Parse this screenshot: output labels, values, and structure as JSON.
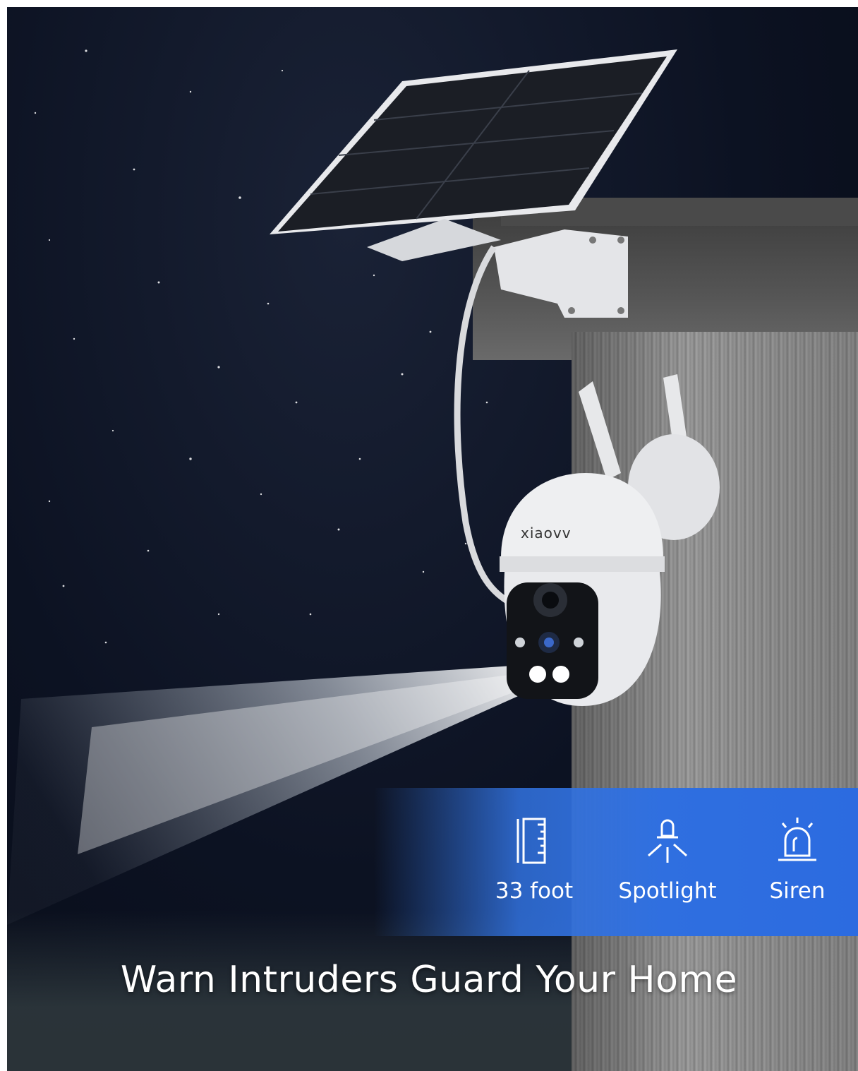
{
  "brand": "xiaovv",
  "features": [
    {
      "label": "33 foot",
      "icon": "ruler-icon"
    },
    {
      "label": "Spotlight",
      "icon": "spotlight-icon"
    },
    {
      "label": "Siren",
      "icon": "siren-icon"
    }
  ],
  "headline": "Warn Intruders Guard Your Home",
  "colors": {
    "panel_blue": "#2f6fe0",
    "night_sky": "#0c1222"
  }
}
